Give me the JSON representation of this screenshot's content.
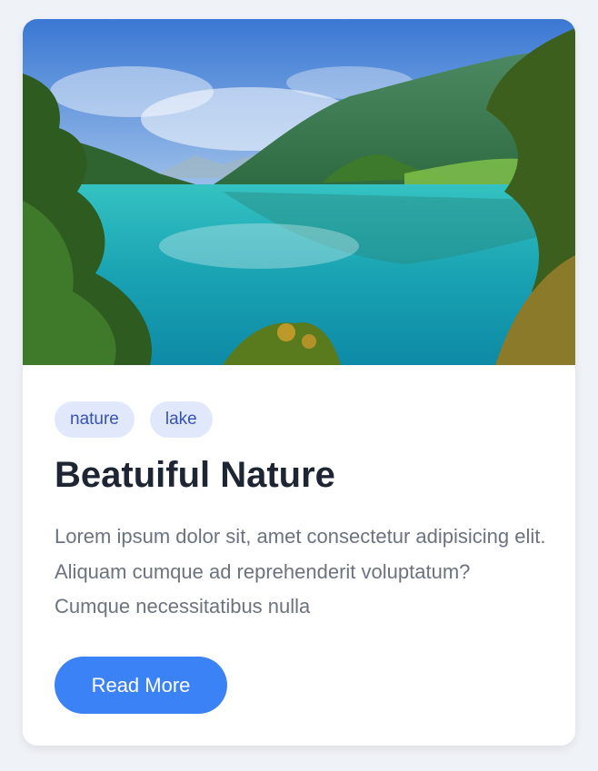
{
  "card": {
    "image": {
      "semantic": "lake-landscape-photo",
      "colors": {
        "sky_top": "#3f7fd8",
        "sky_light": "#dbe8f5",
        "mountain": "#3f7a55",
        "water": "#1aa6b0",
        "foliage": "#2f5f23"
      }
    },
    "tags": [
      "nature",
      "lake"
    ],
    "title": "Beatuiful Nature",
    "description": "Lorem ipsum dolor sit, amet consectetur adipisicing elit. Aliquam cumque ad reprehenderit voluptatum? Cumque necessitatibus nulla",
    "button_label": "Read More"
  },
  "colors": {
    "background": "#eff2f7",
    "tag_bg": "#e1e8fb",
    "tag_text": "#3653b6",
    "title": "#1f2633",
    "body_text": "#6b7280",
    "button": "#3b82f6"
  }
}
